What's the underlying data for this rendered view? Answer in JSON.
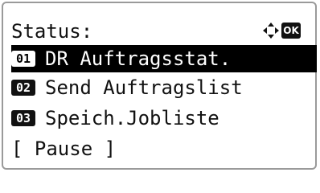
{
  "screen": {
    "title": "Status:",
    "ok_label": "OK"
  },
  "menu": {
    "items": [
      {
        "number": "01",
        "label": "DR Auftragsstat."
      },
      {
        "number": "02",
        "label": "Send Auftragslist"
      },
      {
        "number": "03",
        "label": "Speich.Jobliste"
      }
    ],
    "pause_label": "[ Pause ]"
  }
}
